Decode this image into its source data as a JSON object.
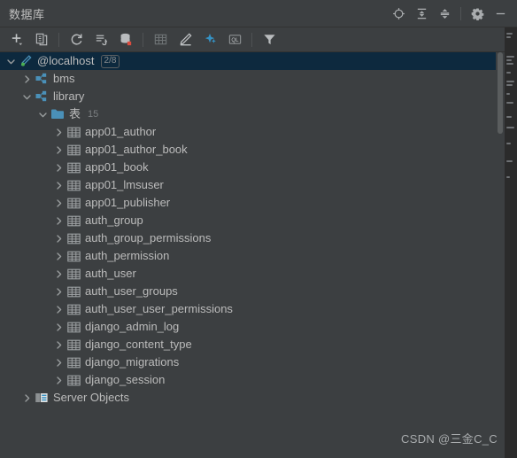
{
  "window": {
    "title": "数据库",
    "actions": [
      {
        "name": "locate-icon",
        "label": "Scroll from Source"
      },
      {
        "name": "expand-all-icon",
        "label": "Expand All"
      },
      {
        "name": "collapse-all-icon",
        "label": "Collapse All"
      },
      {
        "name": "gear-icon",
        "label": "Options"
      },
      {
        "name": "minimize-icon",
        "label": "Hide"
      }
    ]
  },
  "toolbar": {
    "buttons": [
      {
        "name": "add-icon",
        "label": "New"
      },
      {
        "name": "duplicate-icon",
        "label": "Duplicate"
      },
      {
        "name": "refresh-icon",
        "label": "Refresh"
      },
      {
        "name": "sync-schema-icon",
        "label": "Synchronize"
      },
      {
        "name": "database-color-icon",
        "label": "Database Color"
      },
      {
        "name": "table-editor-icon",
        "label": "Open Table Editor"
      },
      {
        "name": "modify-icon",
        "label": "Modify"
      },
      {
        "name": "magic-icon",
        "label": "Jump to Query Console"
      },
      {
        "name": "ql-icon",
        "label": "Query Console"
      },
      {
        "name": "filter-icon",
        "label": "Filter"
      }
    ]
  },
  "tree": {
    "nodes": [
      {
        "name": "connection-localhost",
        "label": "@localhost",
        "icon": "connection-icon",
        "badge": "2/8",
        "indent": 0,
        "expanded": true,
        "selected": true
      },
      {
        "name": "schema-bms",
        "label": "bms",
        "icon": "schema-icon",
        "indent": 1,
        "expanded": false,
        "selected": false
      },
      {
        "name": "schema-library",
        "label": "library",
        "icon": "schema-icon",
        "indent": 1,
        "expanded": true,
        "selected": false
      },
      {
        "name": "folder-tables",
        "label": "表",
        "icon": "folder-icon",
        "count": "15",
        "indent": 2,
        "expanded": true,
        "selected": false
      },
      {
        "name": "table-app01-author",
        "label": "app01_author",
        "icon": "table-icon",
        "indent": 3,
        "expanded": false,
        "selected": false
      },
      {
        "name": "table-app01-author-book",
        "label": "app01_author_book",
        "icon": "table-icon",
        "indent": 3,
        "expanded": false,
        "selected": false
      },
      {
        "name": "table-app01-book",
        "label": "app01_book",
        "icon": "table-icon",
        "indent": 3,
        "expanded": false,
        "selected": false
      },
      {
        "name": "table-app01-lmsuser",
        "label": "app01_lmsuser",
        "icon": "table-icon",
        "indent": 3,
        "expanded": false,
        "selected": false
      },
      {
        "name": "table-app01-publisher",
        "label": "app01_publisher",
        "icon": "table-icon",
        "indent": 3,
        "expanded": false,
        "selected": false
      },
      {
        "name": "table-auth-group",
        "label": "auth_group",
        "icon": "table-icon",
        "indent": 3,
        "expanded": false,
        "selected": false
      },
      {
        "name": "table-auth-group-permissions",
        "label": "auth_group_permissions",
        "icon": "table-icon",
        "indent": 3,
        "expanded": false,
        "selected": false
      },
      {
        "name": "table-auth-permission",
        "label": "auth_permission",
        "icon": "table-icon",
        "indent": 3,
        "expanded": false,
        "selected": false
      },
      {
        "name": "table-auth-user",
        "label": "auth_user",
        "icon": "table-icon",
        "indent": 3,
        "expanded": false,
        "selected": false
      },
      {
        "name": "table-auth-user-groups",
        "label": "auth_user_groups",
        "icon": "table-icon",
        "indent": 3,
        "expanded": false,
        "selected": false
      },
      {
        "name": "table-auth-user-user-permissions",
        "label": "auth_user_user_permissions",
        "icon": "table-icon",
        "indent": 3,
        "expanded": false,
        "selected": false
      },
      {
        "name": "table-django-admin-log",
        "label": "django_admin_log",
        "icon": "table-icon",
        "indent": 3,
        "expanded": false,
        "selected": false
      },
      {
        "name": "table-django-content-type",
        "label": "django_content_type",
        "icon": "table-icon",
        "indent": 3,
        "expanded": false,
        "selected": false
      },
      {
        "name": "table-django-migrations",
        "label": "django_migrations",
        "icon": "table-icon",
        "indent": 3,
        "expanded": false,
        "selected": false
      },
      {
        "name": "table-django-session",
        "label": "django_session",
        "icon": "table-icon",
        "indent": 3,
        "expanded": false,
        "selected": false
      },
      {
        "name": "server-objects",
        "label": "Server Objects",
        "icon": "server-objects-icon",
        "indent": 1,
        "expanded": false,
        "selected": false
      }
    ]
  },
  "watermark": {
    "text": "CSDN @三金C_C"
  },
  "colors": {
    "background": "#3c3f41",
    "selection": "#0d293e",
    "text": "#bbbbbb",
    "accent_blue": "#3592c4",
    "accent_teal": "#4a90b8",
    "badge_red": "#db5c5c",
    "minimap_bg": "#2b2b2b"
  }
}
